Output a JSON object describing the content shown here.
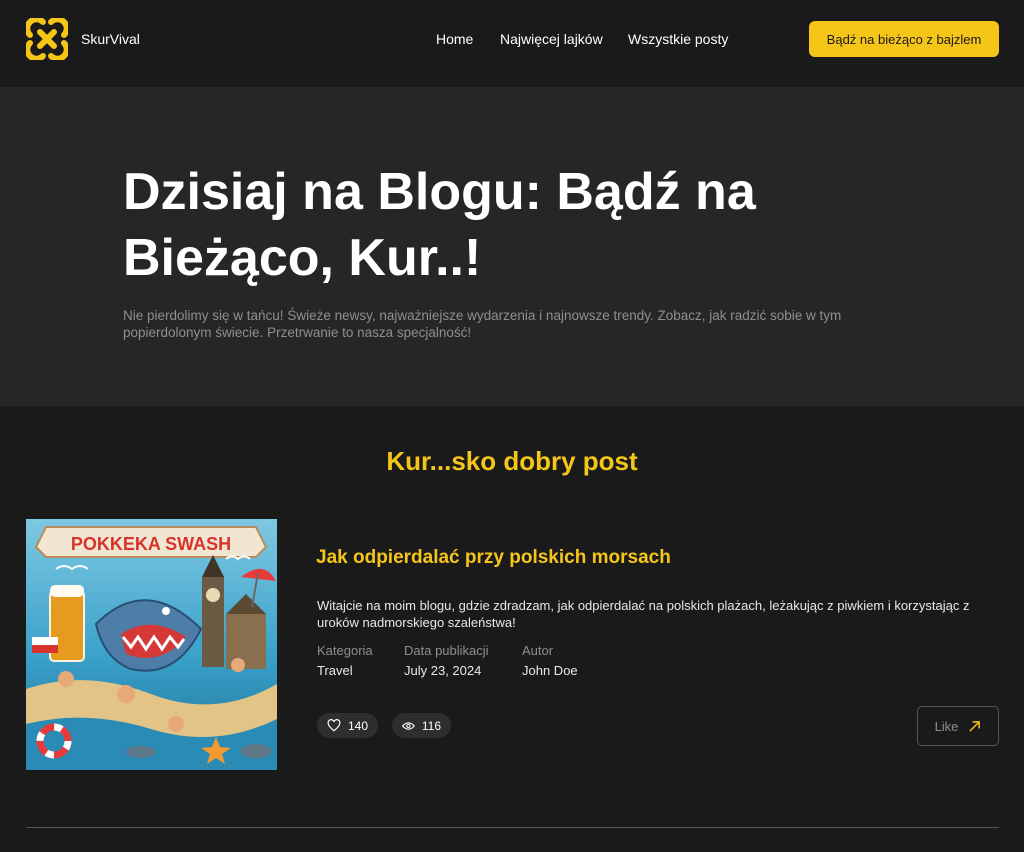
{
  "header": {
    "brand": "SkurVival",
    "nav": [
      "Home",
      "Najwięcej lajków",
      "Wszystkie posty"
    ],
    "cta": "Bądź na bieżąco z bajzlem"
  },
  "hero": {
    "title_line1": "Dzisiaj na Blogu: Bądź na",
    "title_line2": "Bieżąco, Kur..!",
    "description_line1": "Nie pierdolimy się w tańcu! Świeże newsy, najważniejsze wydarzenia i najnowsze trendy. Zobacz, jak radzić sobie w tym",
    "description_line2": "popierdolonym świecie. Przetrwanie to nasza specjalność!"
  },
  "section": {
    "title": "Kur...sko dobry post"
  },
  "post": {
    "image_caption": "POKKEKA SWASH",
    "title": "Jak odpierdalać przy polskich morsach",
    "excerpt": "Witajcie na moim blogu, gdzie zdradzam, jak odpierdalać na polskich plażach, leżakując z piwkiem i korzystając z uroków nadmorskiego szaleństwa!",
    "meta": {
      "category_label": "Kategoria",
      "category_value": "Travel",
      "date_label": "Data publikacji",
      "date_value": "July 23, 2024",
      "author_label": "Autor",
      "author_value": "John Doe"
    },
    "likes": "140",
    "views": "116",
    "like_button": "Like"
  },
  "colors": {
    "accent": "#f5c518",
    "background": "#1a1a1a",
    "hero_background": "#262626"
  },
  "icons": [
    "logo-icon",
    "heart-icon",
    "eye-icon",
    "arrow-up-right-icon"
  ]
}
